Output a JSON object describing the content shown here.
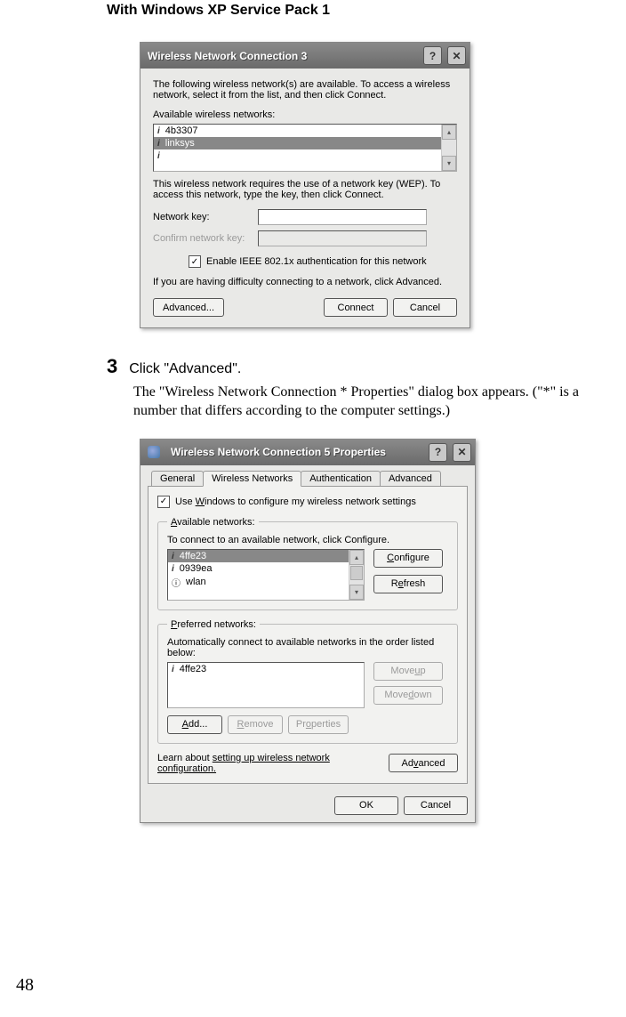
{
  "heading": "With Windows XP Service Pack 1",
  "step_number": "3",
  "step_text": "Click \"Advanced\".",
  "body_text": "The \"Wireless Network Connection * Properties\" dialog box appears. (\"*\" is a number that differs according to the computer settings.)",
  "page_number": "48",
  "dlg1": {
    "title": "Wireless Network Connection 3",
    "intro": "The following wireless network(s) are available. To access a wireless network, select it from the list, and then click Connect.",
    "avail_label": "Available wireless networks:",
    "items": [
      "4b3307",
      "linksys"
    ],
    "selected_index": 1,
    "wep_text": "This wireless network requires the use of a network key (WEP). To access this network, type the key, then click Connect.",
    "key_label": "Network key:",
    "confirm_label": "Confirm network key:",
    "ieee_label": "Enable IEEE 802.1x authentication for this network",
    "difficulty": "If you are having difficulty connecting to a network, click Advanced.",
    "advanced_btn": "Advanced...",
    "connect_btn": "Connect",
    "cancel_btn": "Cancel"
  },
  "dlg2": {
    "title": "Wireless Network Connection 5 Properties",
    "tabs": [
      "General",
      "Wireless Networks",
      "Authentication",
      "Advanced"
    ],
    "active_tab_index": 1,
    "use_windows": "Use Windows to configure my wireless network settings",
    "available_legend": "Available networks:",
    "available_hint": "To connect to an available network, click Configure.",
    "available_items": [
      "4ffe23",
      "0939ea",
      "wlan"
    ],
    "configure_btn": "Configure",
    "refresh_btn": "Refresh",
    "preferred_legend": "Preferred networks:",
    "preferred_hint": "Automatically connect to available networks in the order listed below:",
    "preferred_items": [
      "4ffe23"
    ],
    "moveup_btn": "Move up",
    "movedown_btn": "Move down",
    "add_btn": "Add...",
    "remove_btn": "Remove",
    "properties_btn": "Properties",
    "learn_text": "Learn about setting up wireless network configuration.",
    "advanced_btn": "Advanced",
    "ok_btn": "OK",
    "cancel_btn": "Cancel"
  }
}
